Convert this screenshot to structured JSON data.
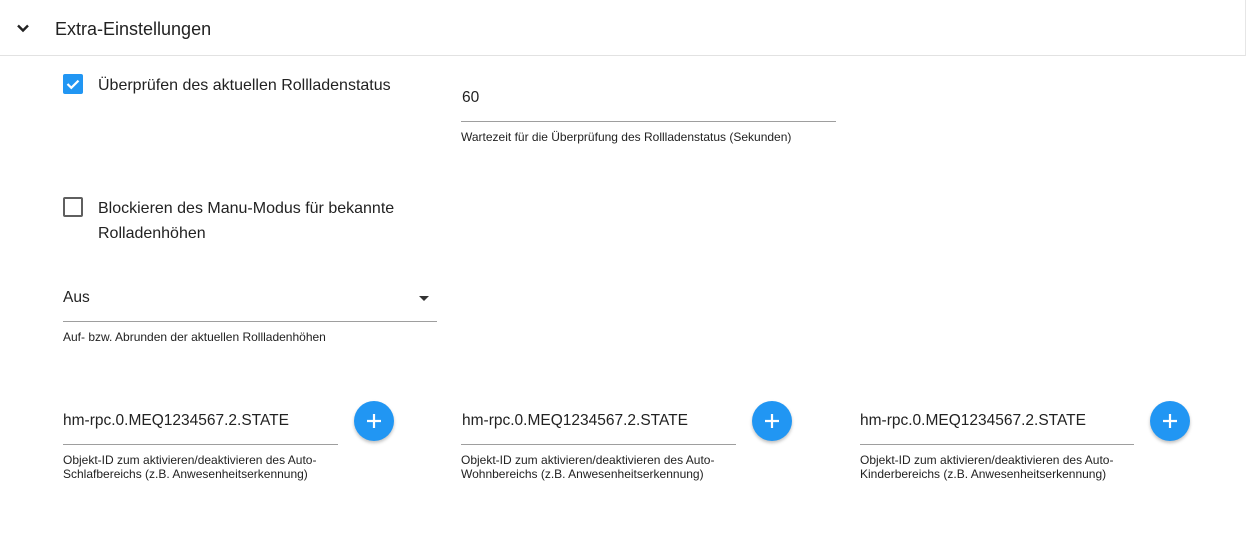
{
  "section": {
    "title": "Extra-Einstellungen",
    "expand_icon": "chevron-down-icon"
  },
  "check_status": {
    "checked": true,
    "label": "Überprüfen des aktuellen Rollladenstatus",
    "wait_value": "60",
    "wait_helper": "Wartezeit für die Überprüfung des Rollladenstatus (Sekunden)"
  },
  "block_manu": {
    "checked": false,
    "label": "Blockieren des Manu-Modus für bekannte Rolladenhöhen"
  },
  "rounding": {
    "selected": "Aus",
    "helper": "Auf- bzw. Abrunden der aktuellen Rollladenhöhen"
  },
  "object_ids": [
    {
      "value": "hm-rpc.0.MEQ1234567.2.STATE",
      "helper": "Objekt-ID zum aktivieren/deaktivieren des Auto-Schlafbereichs (z.B. Anwesenheitserkennung)",
      "button_icon": "plus-icon"
    },
    {
      "value": "hm-rpc.0.MEQ1234567.2.STATE",
      "helper": "Objekt-ID zum aktivieren/deaktivieren des Auto-Wohnbereichs (z.B. Anwesenheitserkennung)",
      "button_icon": "plus-icon"
    },
    {
      "value": "hm-rpc.0.MEQ1234567.2.STATE",
      "helper": "Objekt-ID zum aktivieren/deaktivieren des Auto-Kinderbereichs (z.B. Anwesenheitserkennung)",
      "button_icon": "plus-icon"
    }
  ],
  "colors": {
    "accent": "#2196f3",
    "underline": "#9e9e9e"
  }
}
